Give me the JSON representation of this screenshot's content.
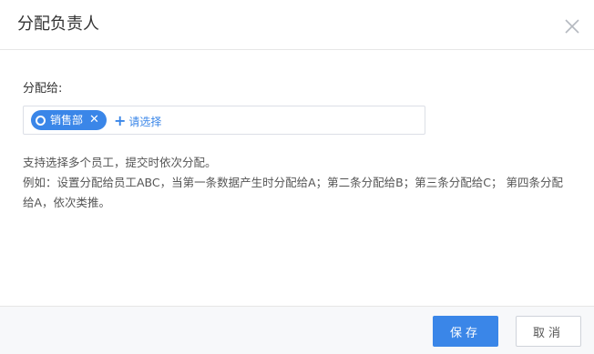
{
  "dialog": {
    "title": "分配负责人",
    "close_icon": "close-icon"
  },
  "form": {
    "label": "分配给:",
    "tags": [
      {
        "label": "销售部",
        "icon": "circle-icon",
        "remove_icon": "close-icon"
      }
    ],
    "add": {
      "icon": "plus-icon",
      "label": "请选择"
    }
  },
  "help": {
    "line1": "支持选择多个员工，提交时依次分配。",
    "line2": "例如：设置分配给员工ABC，当第一条数据产生时分配给A；第二条分配给B；第三条分配给C； 第四条分配给A，依次类推。"
  },
  "footer": {
    "save_label": "保存",
    "cancel_label": "取消"
  },
  "colors": {
    "accent": "#3a86e8",
    "footer_bg": "#f7f8fa",
    "border": "#e6e6e6"
  }
}
